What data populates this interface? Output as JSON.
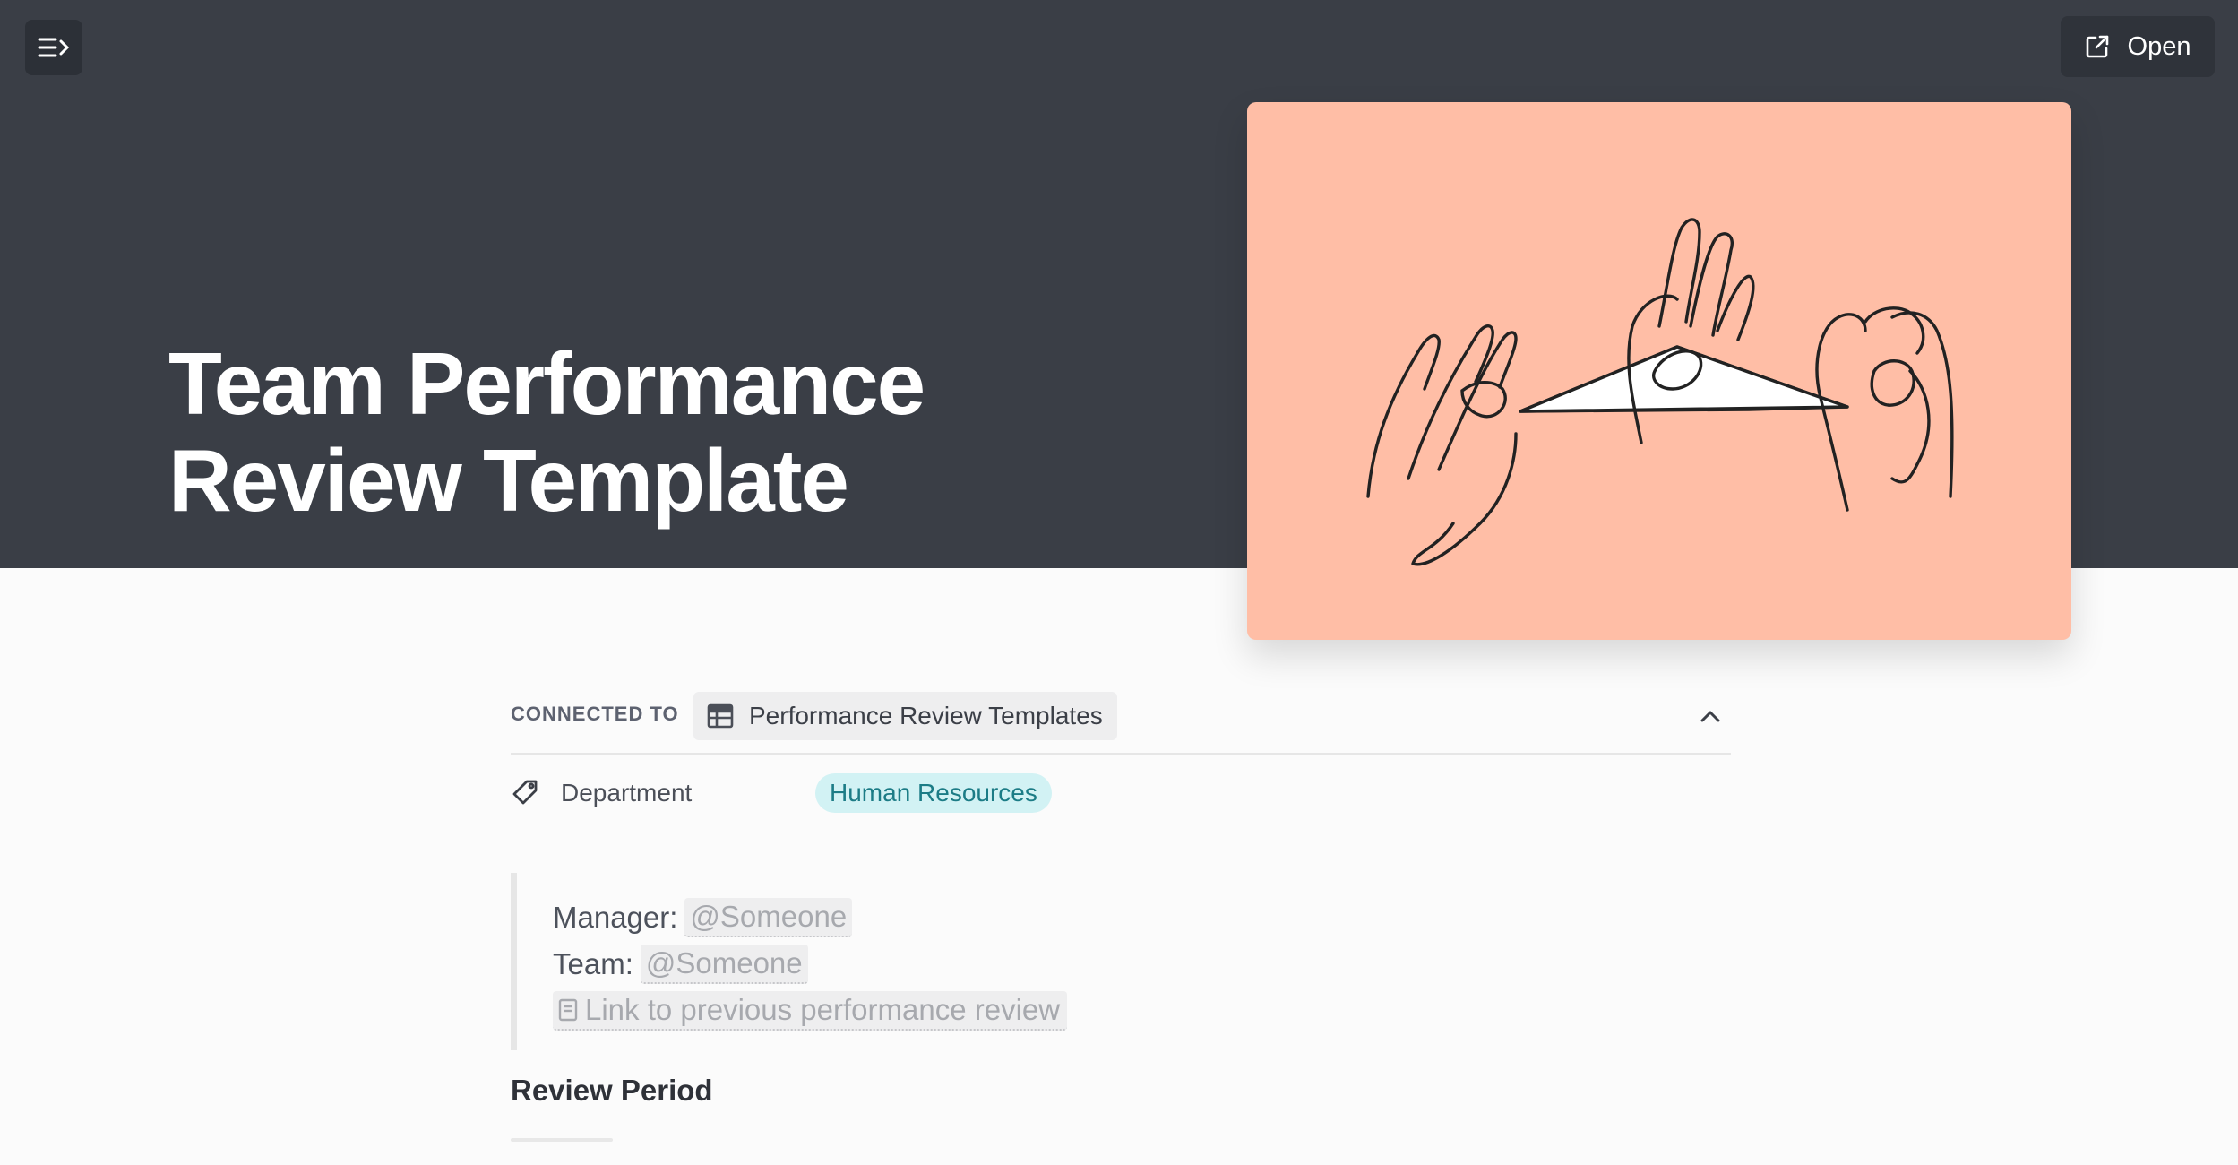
{
  "header": {
    "menu_icon": "sidebar-toggle-icon",
    "open_button": {
      "icon": "external-link-icon",
      "label": "Open"
    }
  },
  "page": {
    "title_line1": "Team Performance",
    "title_line2": "Review Template",
    "cover": {
      "description_icon": "hands-illustration",
      "background": "#ffbea6"
    }
  },
  "connection": {
    "label": "CONNECTED TO",
    "database_icon": "table-icon",
    "database_name": "Performance Review Templates",
    "collapse_icon": "chevron-up-icon"
  },
  "properties": [
    {
      "icon": "tag-icon",
      "name": "Department",
      "value": "Human Resources",
      "value_color": "#d2f2f4"
    }
  ],
  "callout": {
    "manager_label": "Manager:",
    "manager_value": "@Someone",
    "team_label": "Team:",
    "team_value": "@Someone",
    "link_icon": "page-icon",
    "link_text": "Link to previous performance review"
  },
  "section": {
    "heading": "Review Period"
  },
  "colors": {
    "hero_bg": "#3a3e46",
    "page_bg": "#fbfbfb",
    "tag_bg": "#d2f2f4",
    "tag_text": "#1c7c86"
  }
}
